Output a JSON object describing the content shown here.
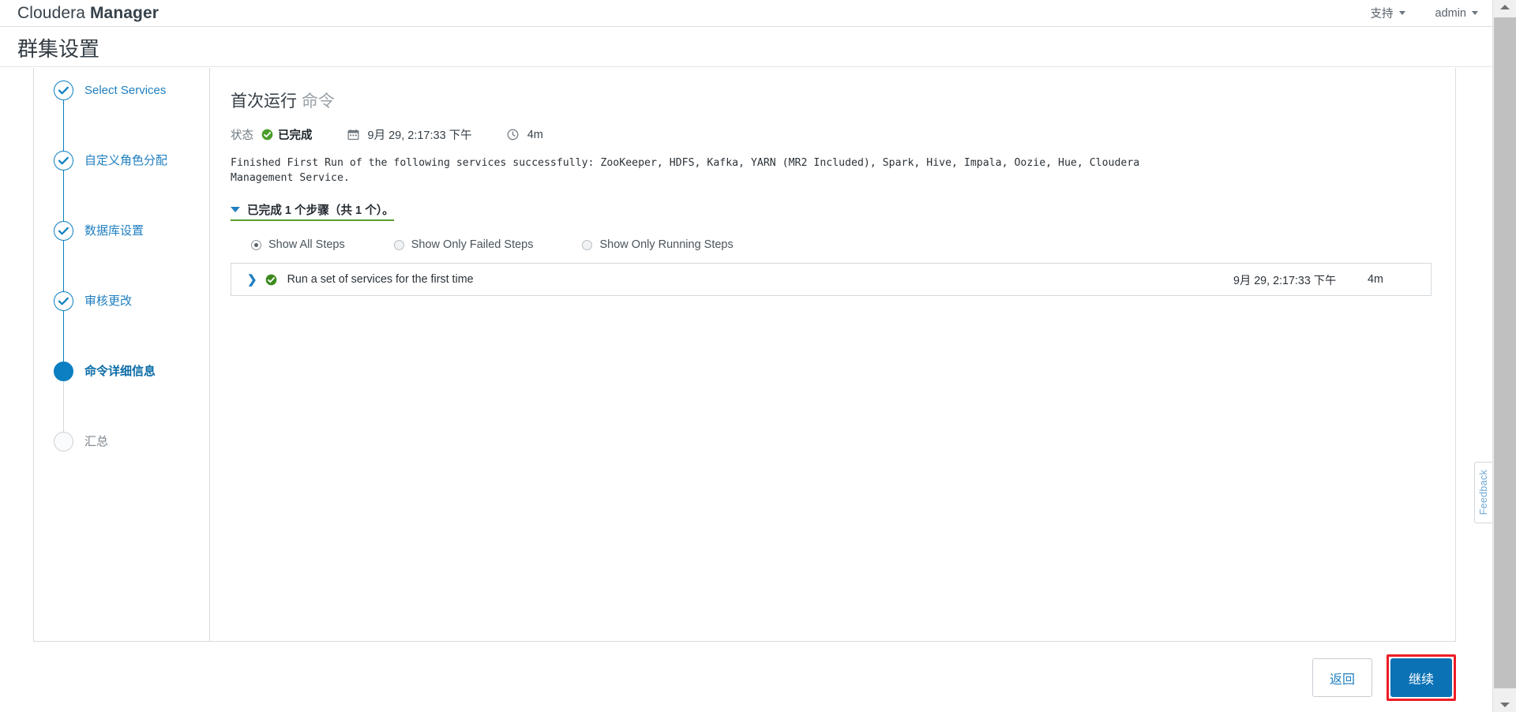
{
  "topbar": {
    "brand_light": "Cloudera",
    "brand_bold": "Manager",
    "support_label": "支持",
    "user_label": "admin"
  },
  "page": {
    "title": "群集设置"
  },
  "sidebar": {
    "items": [
      {
        "label": "Select Services",
        "state": "done"
      },
      {
        "label": "自定义角色分配",
        "state": "done"
      },
      {
        "label": "数据库设置",
        "state": "done"
      },
      {
        "label": "审核更改",
        "state": "done"
      },
      {
        "label": "命令详细信息",
        "state": "current"
      },
      {
        "label": "汇总",
        "state": "todo"
      }
    ]
  },
  "command": {
    "title_main": "首次运行",
    "title_muted": "命令",
    "status_label": "状态",
    "status_value": "已完成",
    "date_value": "9月 29, 2:17:33 下午",
    "duration_value": "4m",
    "description": "Finished First Run of the following services successfully: ZooKeeper, HDFS, Kafka, YARN (MR2 Included), Spark, Hive, Impala, Oozie, Hue, Cloudera Management Service.",
    "collapse_label": "已完成 1 个步骤（共 1 个）。",
    "filters": [
      {
        "label": "Show All Steps",
        "selected": true
      },
      {
        "label": "Show Only Failed Steps",
        "selected": false
      },
      {
        "label": "Show Only Running Steps",
        "selected": false
      }
    ],
    "steps_table": {
      "rows": [
        {
          "name": "Run a set of services for the first time",
          "time": "9月 29, 2:17:33 下午",
          "duration": "4m"
        }
      ]
    }
  },
  "footer": {
    "back_label": "返回",
    "next_label": "继续"
  },
  "feedback": {
    "label": "Feedback"
  },
  "colors": {
    "accent_blue": "#0b7fc1",
    "primary_button": "#0b72b5",
    "success_green": "#4a9e2a",
    "highlight_red": "#ee1c25",
    "underline_green": "#5a9e2a"
  }
}
